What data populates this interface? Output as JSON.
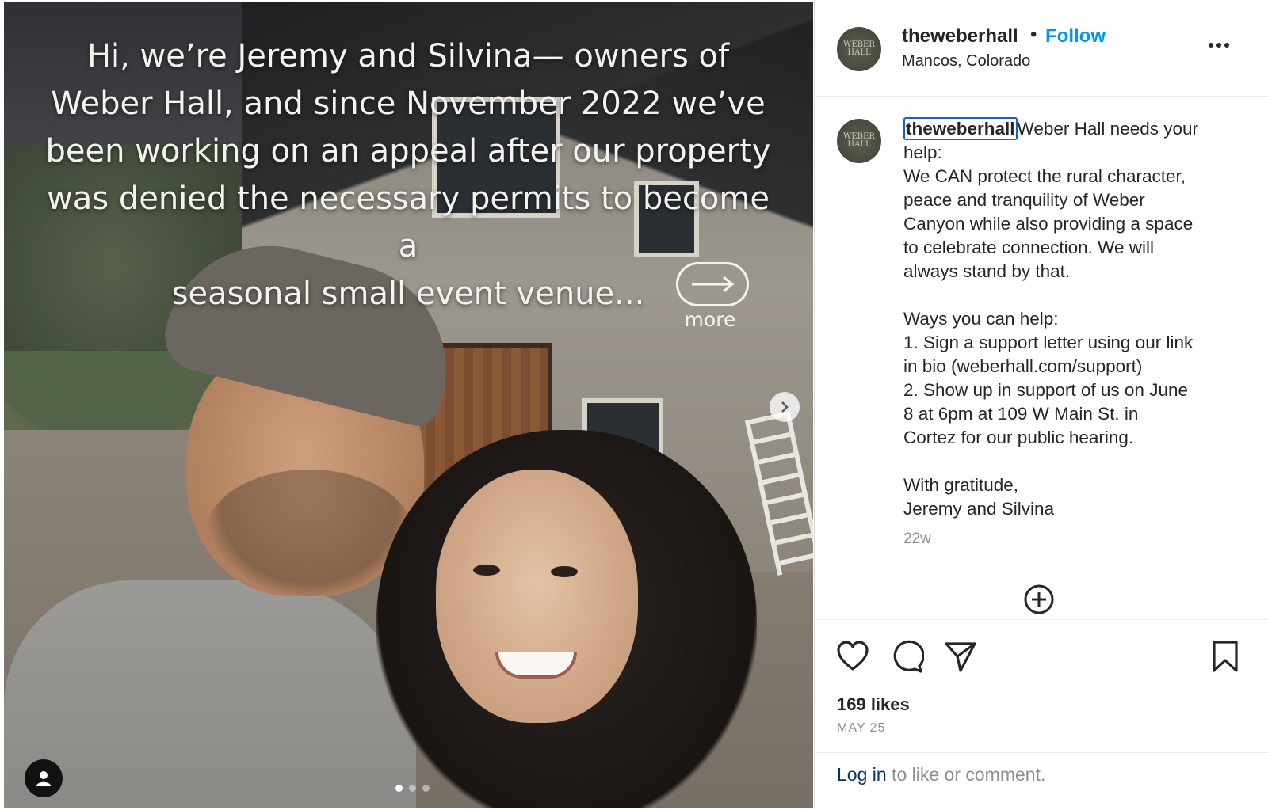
{
  "post": {
    "image_caption_lines": [
      "Hi, we’re Jeremy and Silvina— owners of",
      "Weber Hall, and since November 2022 we’ve",
      "been working on an appeal after our property",
      "was denied the necessary permits to become a",
      "seasonal small event venue..."
    ],
    "more_label": "more",
    "carousel_total": 3,
    "carousel_active": 1
  },
  "header": {
    "username": "theweberhall",
    "separator": "•",
    "follow_label": "Follow",
    "location": "Mancos, Colorado",
    "avatar_text": "WEBER HALL"
  },
  "caption": {
    "username": "theweberhall",
    "first_line_rest": "Weber Hall needs your",
    "lines": [
      "help:",
      "We CAN protect the rural character,",
      "peace and tranquility of Weber",
      "Canyon while also providing a space",
      "to celebrate connection. We will",
      "always stand by that.",
      "",
      "Ways you can help:",
      "1. Sign a support letter using our link",
      "in bio (weberhall.com/support)",
      "2. Show up in support of us on June",
      "8 at 6pm at 109 W Main St. in",
      "Cortez for our public hearing.",
      "",
      "With gratitude,",
      "Jeremy and Silvina"
    ],
    "time_ago": "22w"
  },
  "actions": {
    "likes": "169 likes",
    "date": "MAY 25",
    "icons": [
      "heart-icon",
      "comment-icon",
      "share-icon",
      "bookmark-icon",
      "plus-circle-icon"
    ]
  },
  "footer": {
    "login_link": "Log in",
    "login_rest": " to like or comment."
  },
  "colors": {
    "follow": "#0095f6",
    "link": "#00376b",
    "muted": "#8e8e8e",
    "focus_outline": "#1a5fd1"
  }
}
